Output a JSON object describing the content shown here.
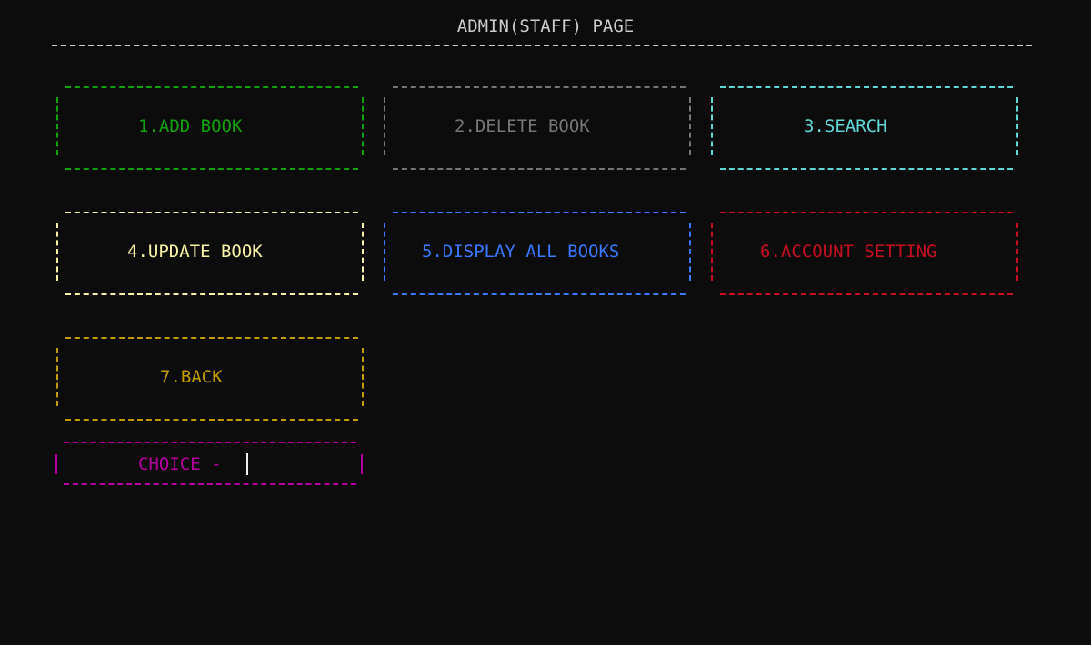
{
  "window": {
    "title": "ADMIN(STAFF) PAGE"
  },
  "menu": {
    "items": [
      {
        "label": "1.ADD BOOK",
        "color": "#13a10e"
      },
      {
        "label": "2.DELETE BOOK",
        "color": "#767676"
      },
      {
        "label": "3.SEARCH",
        "color": "#61d6d6"
      },
      {
        "label": "4.UPDATE BOOK",
        "color": "#f9f1a5"
      },
      {
        "label": "5.DISPLAY ALL BOOKS",
        "color": "#3b78ff"
      },
      {
        "label": "6.ACCOUNT SETTING",
        "color": "#c50f1f"
      },
      {
        "label": "7.BACK",
        "color": "#c19c00"
      }
    ]
  },
  "prompt": {
    "label": "CHOICE -",
    "value": "",
    "color": "#b4009e"
  },
  "colors": {
    "background": "#0c0c0c",
    "foreground": "#cccccc"
  }
}
